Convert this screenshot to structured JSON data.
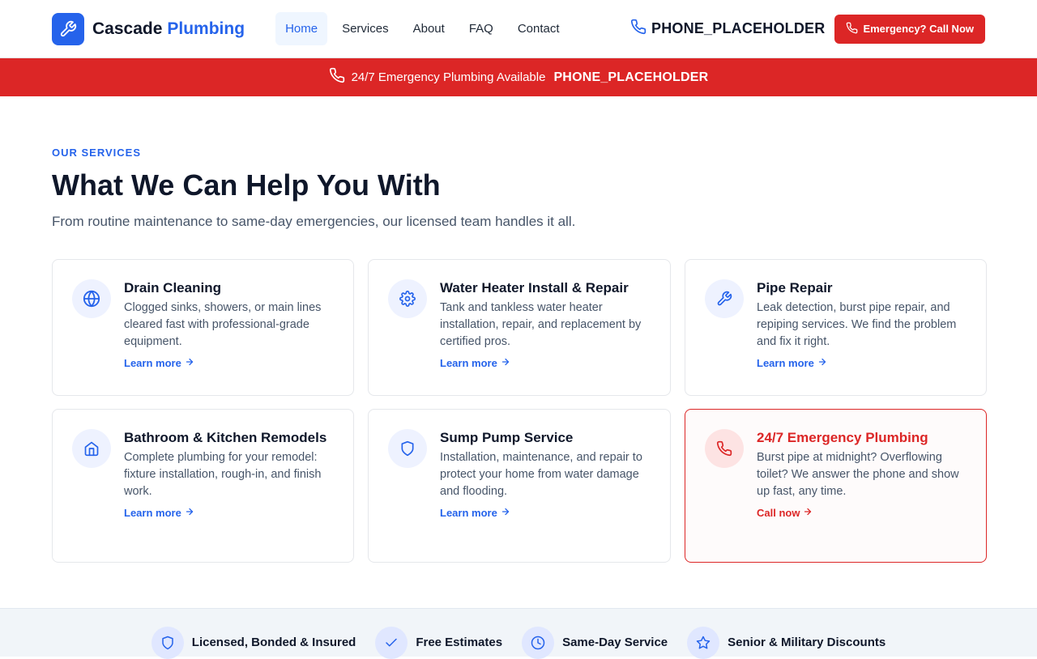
{
  "header": {
    "brand_name": "Cascade",
    "brand_accent": "Plumbing",
    "nav": [
      {
        "label": "Home",
        "active": true
      },
      {
        "label": "Services"
      },
      {
        "label": "About"
      },
      {
        "label": "FAQ"
      },
      {
        "label": "Contact"
      }
    ],
    "phone": "PHONE_PLACEHOLDER",
    "cta_label": "Emergency? Call Now"
  },
  "emergency_bar": {
    "text": "24/7 Emergency Plumbing Available",
    "phone": "PHONE_PLACEHOLDER"
  },
  "services": {
    "eyebrow": "OUR SERVICES",
    "title": "What We Can Help You With",
    "subtitle": "From routine maintenance to same-day emergencies, our licensed team handles it all.",
    "cards": [
      {
        "icon": "globe-icon",
        "title": "Drain Cleaning",
        "desc": "Clogged sinks, showers, or main lines cleared fast with professional-grade equipment.",
        "link": "Learn more"
      },
      {
        "icon": "gear-icon",
        "title": "Water Heater Install & Repair",
        "desc": "Tank and tankless water heater installation, repair, and replacement by certified pros.",
        "link": "Learn more"
      },
      {
        "icon": "wrench-icon",
        "title": "Pipe Repair",
        "desc": "Leak detection, burst pipe repair, and repiping services. We find the problem and fix it right.",
        "link": "Learn more"
      },
      {
        "icon": "home-icon",
        "title": "Bathroom & Kitchen Remodels",
        "desc": "Complete plumbing for your remodel: fixture installation, rough-in, and finish work.",
        "link": "Learn more"
      },
      {
        "icon": "shield-icon",
        "title": "Sump Pump Service",
        "desc": "Installation, maintenance, and repair to protect your home from water damage and flooding.",
        "link": "Learn more"
      },
      {
        "icon": "phone-icon",
        "title": "24/7 Emergency Plumbing",
        "desc": "Burst pipe at midnight? Overflowing toilet? We answer the phone and show up fast, any time.",
        "link": "Call now"
      }
    ]
  },
  "trust": [
    {
      "icon": "shield-icon",
      "label": "Licensed, Bonded & Insured"
    },
    {
      "icon": "check-icon",
      "label": "Free Estimates"
    },
    {
      "icon": "clock-icon",
      "label": "Same-Day Service"
    },
    {
      "icon": "star-icon",
      "label": "Senior & Military Discounts"
    }
  ],
  "colors": {
    "brand": "#2563eb",
    "emergency": "#dc2626",
    "text": "#0f172a",
    "muted": "#475569"
  }
}
